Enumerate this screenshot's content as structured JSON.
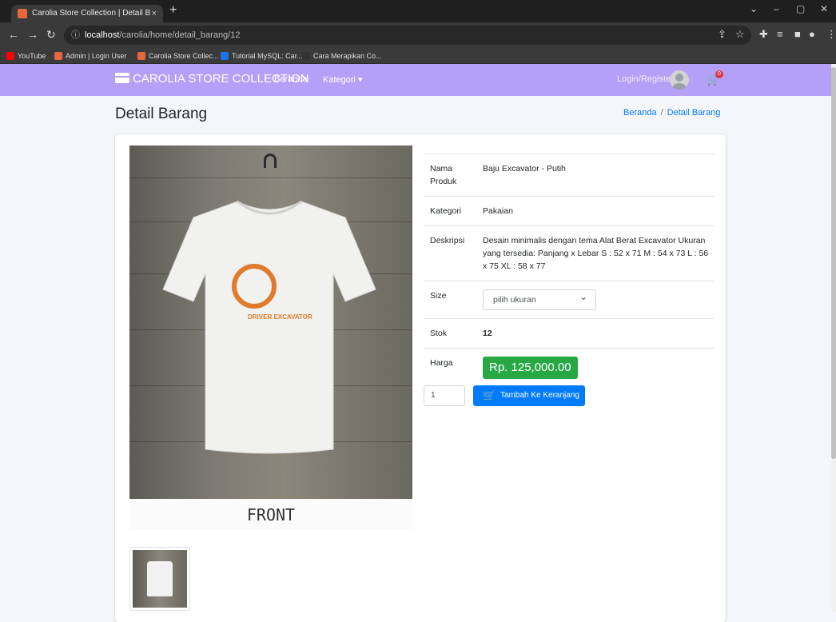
{
  "browser": {
    "tab_title": "Carolia Store Collection | Detail B",
    "tab_close": "×",
    "new_tab": "+",
    "url_host": "localhost",
    "url_path": "/carolia/home/detail_barang/12",
    "bookmarks": [
      {
        "label": "YouTube",
        "color": "#ff0000"
      },
      {
        "label": "Admin | Login User",
        "color": "#e8663d"
      },
      {
        "label": "Carolia Store Collec...",
        "color": "#e8663d"
      },
      {
        "label": "Tutorial MySQL: Car...",
        "color": "#1a73e8"
      },
      {
        "label": "Cara Merapikan Co...",
        "color": "#333333"
      }
    ]
  },
  "navbar": {
    "brand": "CAROLIA STORE COLLECTION",
    "links": [
      "Beranda",
      "Kategori ▾"
    ],
    "login": "Login/Register",
    "cart_count": "0",
    "background": "#b4a0f7"
  },
  "page": {
    "title": "Detail Barang",
    "breadcrumb": [
      "Beranda",
      "Detail Barang"
    ]
  },
  "product": {
    "photo_caption": "FRONT",
    "print_text": "DRIVER EXCAVATOR",
    "rows": [
      {
        "label": "Nama Produk",
        "value": "Baju Excavator - Putih"
      },
      {
        "label": "Kategori",
        "value": "Pakaian"
      },
      {
        "label": "Deskripsi",
        "value": "Desain minimalis dengan tema Alat Berat Excavator Ukuran yang tersedia: Panjang x Lebar S : 52 x 71 M : 54 x 73 L : 56 x 75 XL : 58 x 77"
      }
    ],
    "size_label": "Size",
    "size_selected": "pilih ukuran",
    "stock_label": "Stok",
    "stock_value": "12",
    "price_label": "Harga",
    "price_value": "Rp. 125,000.00",
    "qty_value": "1",
    "add_to_cart": "Tambah Ke Keranjang"
  },
  "colors": {
    "price_bg": "#28a745",
    "button_bg": "#007bff",
    "link": "#007bff"
  }
}
